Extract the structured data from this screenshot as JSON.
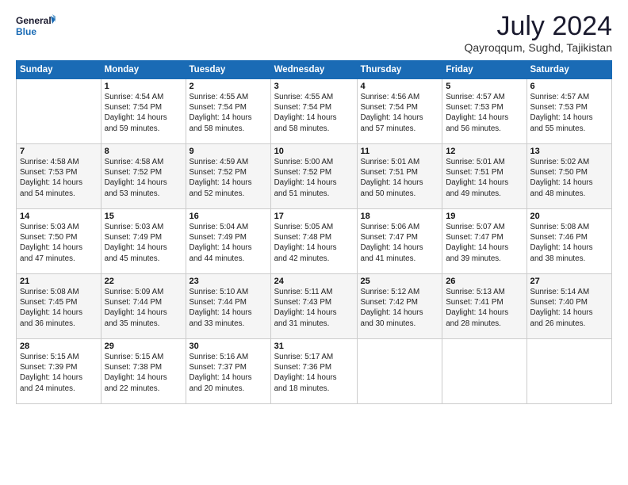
{
  "logo": {
    "line1": "General",
    "line2": "Blue"
  },
  "title": "July 2024",
  "location": "Qayroqqum, Sughd, Tajikistan",
  "days_of_week": [
    "Sunday",
    "Monday",
    "Tuesday",
    "Wednesday",
    "Thursday",
    "Friday",
    "Saturday"
  ],
  "weeks": [
    [
      {
        "day": "",
        "info": ""
      },
      {
        "day": "1",
        "info": "Sunrise: 4:54 AM\nSunset: 7:54 PM\nDaylight: 14 hours\nand 59 minutes."
      },
      {
        "day": "2",
        "info": "Sunrise: 4:55 AM\nSunset: 7:54 PM\nDaylight: 14 hours\nand 58 minutes."
      },
      {
        "day": "3",
        "info": "Sunrise: 4:55 AM\nSunset: 7:54 PM\nDaylight: 14 hours\nand 58 minutes."
      },
      {
        "day": "4",
        "info": "Sunrise: 4:56 AM\nSunset: 7:54 PM\nDaylight: 14 hours\nand 57 minutes."
      },
      {
        "day": "5",
        "info": "Sunrise: 4:57 AM\nSunset: 7:53 PM\nDaylight: 14 hours\nand 56 minutes."
      },
      {
        "day": "6",
        "info": "Sunrise: 4:57 AM\nSunset: 7:53 PM\nDaylight: 14 hours\nand 55 minutes."
      }
    ],
    [
      {
        "day": "7",
        "info": "Sunrise: 4:58 AM\nSunset: 7:53 PM\nDaylight: 14 hours\nand 54 minutes."
      },
      {
        "day": "8",
        "info": "Sunrise: 4:58 AM\nSunset: 7:52 PM\nDaylight: 14 hours\nand 53 minutes."
      },
      {
        "day": "9",
        "info": "Sunrise: 4:59 AM\nSunset: 7:52 PM\nDaylight: 14 hours\nand 52 minutes."
      },
      {
        "day": "10",
        "info": "Sunrise: 5:00 AM\nSunset: 7:52 PM\nDaylight: 14 hours\nand 51 minutes."
      },
      {
        "day": "11",
        "info": "Sunrise: 5:01 AM\nSunset: 7:51 PM\nDaylight: 14 hours\nand 50 minutes."
      },
      {
        "day": "12",
        "info": "Sunrise: 5:01 AM\nSunset: 7:51 PM\nDaylight: 14 hours\nand 49 minutes."
      },
      {
        "day": "13",
        "info": "Sunrise: 5:02 AM\nSunset: 7:50 PM\nDaylight: 14 hours\nand 48 minutes."
      }
    ],
    [
      {
        "day": "14",
        "info": "Sunrise: 5:03 AM\nSunset: 7:50 PM\nDaylight: 14 hours\nand 47 minutes."
      },
      {
        "day": "15",
        "info": "Sunrise: 5:03 AM\nSunset: 7:49 PM\nDaylight: 14 hours\nand 45 minutes."
      },
      {
        "day": "16",
        "info": "Sunrise: 5:04 AM\nSunset: 7:49 PM\nDaylight: 14 hours\nand 44 minutes."
      },
      {
        "day": "17",
        "info": "Sunrise: 5:05 AM\nSunset: 7:48 PM\nDaylight: 14 hours\nand 42 minutes."
      },
      {
        "day": "18",
        "info": "Sunrise: 5:06 AM\nSunset: 7:47 PM\nDaylight: 14 hours\nand 41 minutes."
      },
      {
        "day": "19",
        "info": "Sunrise: 5:07 AM\nSunset: 7:47 PM\nDaylight: 14 hours\nand 39 minutes."
      },
      {
        "day": "20",
        "info": "Sunrise: 5:08 AM\nSunset: 7:46 PM\nDaylight: 14 hours\nand 38 minutes."
      }
    ],
    [
      {
        "day": "21",
        "info": "Sunrise: 5:08 AM\nSunset: 7:45 PM\nDaylight: 14 hours\nand 36 minutes."
      },
      {
        "day": "22",
        "info": "Sunrise: 5:09 AM\nSunset: 7:44 PM\nDaylight: 14 hours\nand 35 minutes."
      },
      {
        "day": "23",
        "info": "Sunrise: 5:10 AM\nSunset: 7:44 PM\nDaylight: 14 hours\nand 33 minutes."
      },
      {
        "day": "24",
        "info": "Sunrise: 5:11 AM\nSunset: 7:43 PM\nDaylight: 14 hours\nand 31 minutes."
      },
      {
        "day": "25",
        "info": "Sunrise: 5:12 AM\nSunset: 7:42 PM\nDaylight: 14 hours\nand 30 minutes."
      },
      {
        "day": "26",
        "info": "Sunrise: 5:13 AM\nSunset: 7:41 PM\nDaylight: 14 hours\nand 28 minutes."
      },
      {
        "day": "27",
        "info": "Sunrise: 5:14 AM\nSunset: 7:40 PM\nDaylight: 14 hours\nand 26 minutes."
      }
    ],
    [
      {
        "day": "28",
        "info": "Sunrise: 5:15 AM\nSunset: 7:39 PM\nDaylight: 14 hours\nand 24 minutes."
      },
      {
        "day": "29",
        "info": "Sunrise: 5:15 AM\nSunset: 7:38 PM\nDaylight: 14 hours\nand 22 minutes."
      },
      {
        "day": "30",
        "info": "Sunrise: 5:16 AM\nSunset: 7:37 PM\nDaylight: 14 hours\nand 20 minutes."
      },
      {
        "day": "31",
        "info": "Sunrise: 5:17 AM\nSunset: 7:36 PM\nDaylight: 14 hours\nand 18 minutes."
      },
      {
        "day": "",
        "info": ""
      },
      {
        "day": "",
        "info": ""
      },
      {
        "day": "",
        "info": ""
      }
    ]
  ]
}
